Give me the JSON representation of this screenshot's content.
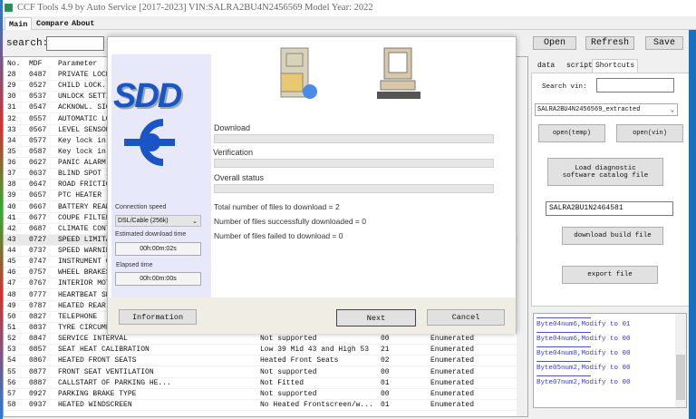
{
  "title": "CCF Tools 4.9 by Auto Service [2017-2023]   VIN:SALRA2BU4N2456569  Model Year: 2022",
  "tabs": [
    "Main",
    "Compare",
    "About"
  ],
  "search_label": "search:",
  "toolbar": {
    "open": "Open",
    "refresh": "Refresh",
    "save": "Save"
  },
  "table": {
    "headers": [
      "No.",
      "MDF",
      "Parameter"
    ],
    "rows": [
      [
        "28",
        "0487",
        "PRIVATE LOCK",
        "",
        "",
        ""
      ],
      [
        "29",
        "0527",
        "CHILD LOCK.",
        "",
        "",
        ""
      ],
      [
        "30",
        "0537",
        "UNLOCK SETTI",
        "",
        "",
        ""
      ],
      [
        "31",
        "0547",
        "ACKNOWL. SIG",
        "",
        "",
        ""
      ],
      [
        "32",
        "0557",
        "AUTOMATIC LO",
        "",
        "",
        ""
      ],
      [
        "33",
        "0567",
        "LEVEL SENSOR",
        "",
        "",
        ""
      ],
      [
        "34",
        "0577",
        "Key lock in",
        "",
        "",
        ""
      ],
      [
        "35",
        "0587",
        "Key lock in",
        "",
        "",
        ""
      ],
      [
        "36",
        "0627",
        "PANIC ALARM",
        "",
        "",
        ""
      ],
      [
        "37",
        "0637",
        "BLIND SPOT I",
        "",
        "",
        ""
      ],
      [
        "38",
        "0647",
        "ROAD FRICTIO",
        "",
        "",
        ""
      ],
      [
        "39",
        "0657",
        "PTC HEATER (",
        "",
        "",
        ""
      ],
      [
        "40",
        "0667",
        "BATTERY REAR",
        "",
        "",
        ""
      ],
      [
        "41",
        "0677",
        "COUPE FILTER",
        "",
        "",
        ""
      ],
      [
        "42",
        "0687",
        "CLIMATE CONT",
        "",
        "",
        ""
      ],
      [
        "43",
        "0727",
        "SPEED LIMITA",
        "",
        "",
        ""
      ],
      [
        "44",
        "0737",
        "SPEED WARNIN",
        "",
        "",
        ""
      ],
      [
        "45",
        "0747",
        "INSTRUMENT C",
        "",
        "",
        ""
      ],
      [
        "46",
        "0757",
        "WHEEL BRAKES",
        "",
        "",
        ""
      ],
      [
        "47",
        "0767",
        "INTERIOR MOT",
        "",
        "",
        ""
      ],
      [
        "48",
        "0777",
        "HEARTBEAT SE",
        "",
        "",
        ""
      ],
      [
        "49",
        "0787",
        "HEATED REAR",
        "",
        "",
        ""
      ],
      [
        "50",
        "0827",
        "TELEPHONE",
        "",
        "",
        ""
      ],
      [
        "51",
        "0837",
        "TYRE CIRCUMF",
        "",
        "",
        ""
      ],
      [
        "52",
        "0847",
        "SERVICE INTERVAL",
        "Not supported",
        "00",
        "Enumerated"
      ],
      [
        "53",
        "0857",
        "SEAT HEAT CALIBRATION",
        "Low 39 Mid 43 and High 53",
        "21",
        "Enumerated"
      ],
      [
        "54",
        "0867",
        "HEATED FRONT SEATS",
        "Heated Front Seats",
        "02",
        "Enumerated"
      ],
      [
        "55",
        "0877",
        "FRONT SEAT VENTILATION",
        "Not supported",
        "00",
        "Enumerated"
      ],
      [
        "56",
        "0887",
        "CALLSTART OF PARKING HE...",
        "Not Fitted",
        "01",
        "Enumerated"
      ],
      [
        "57",
        "0927",
        "PARKING BRAKE TYPE",
        "Not supported",
        "00",
        "Enumerated"
      ],
      [
        "58",
        "0937",
        "HEATED WINDSCREEN",
        "No Heated Frontscreen/w...",
        "01",
        "Enumerated"
      ]
    ]
  },
  "dialog": {
    "logo": "SDD",
    "download_label": "Download",
    "verification_label": "Verification",
    "overall_label": "Overall status",
    "total": "Total number of files to download = 2",
    "success": "Number of files successfully downloaded = 0",
    "failed": "Number of files failed to download = 0",
    "connection_label": "Connection speed",
    "connection_value": "DSL/Cable (256k)",
    "est_label": "Estimated download time",
    "est_value": "00h:00m:02s",
    "elapsed_label": "Elapsed time",
    "elapsed_value": "00h:00m:00s",
    "info": "Information",
    "next": "Next",
    "cancel": "Cancel"
  },
  "right": {
    "tabs": [
      "data",
      "script",
      "Shortcuts"
    ],
    "search_vin_label": "Search vin:",
    "search_vin_value": "",
    "dropdown": "SALRA2BU4N2456569_extracted",
    "open_temp": "open(temp)",
    "open_vin": "open(vin)",
    "load_catalog": "Load diagnostic software catalog file",
    "vin_input": "SALRA2BU1N2464581",
    "download_build": "download build file",
    "export": "export file",
    "log": [
      "Byte04num6,Modify to 01",
      "Byte04num6,Modify to 00",
      "Byte04num8,Modify to 00",
      "Byte05num2,Modify to 00",
      "Byte07num2,Modify to 00"
    ]
  }
}
